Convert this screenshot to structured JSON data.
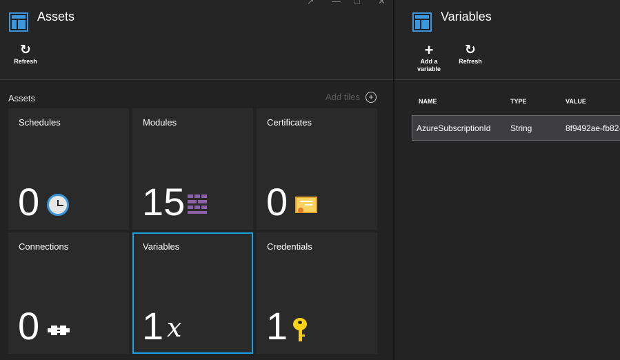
{
  "assets_blade": {
    "title": "Assets",
    "window_controls": [
      "↗",
      "—",
      "□",
      "✕"
    ],
    "commands": [
      {
        "icon": "refresh-icon",
        "label": "Refresh"
      }
    ],
    "section_title": "Assets",
    "add_tiles_label": "Add tiles",
    "tiles": [
      {
        "name": "Schedules",
        "count": "0",
        "icon": "clock-icon"
      },
      {
        "name": "Modules",
        "count": "15",
        "icon": "modules-icon"
      },
      {
        "name": "Certificates",
        "count": "0",
        "icon": "certificate-icon"
      },
      {
        "name": "Connections",
        "count": "0",
        "icon": "plug-icon"
      },
      {
        "name": "Variables",
        "count": "1",
        "icon": "variable-x-icon",
        "variable_symbol": "x",
        "selected": true
      },
      {
        "name": "Credentials",
        "count": "1",
        "icon": "key-icon"
      }
    ]
  },
  "variables_blade": {
    "title": "Variables",
    "commands": [
      {
        "icon": "plus-icon",
        "label_line1": "Add a",
        "label_line2": "variable"
      },
      {
        "icon": "refresh-icon",
        "label": "Refresh"
      }
    ],
    "columns": [
      "NAME",
      "TYPE",
      "VALUE"
    ],
    "rows": [
      {
        "name": "AzureSubscriptionId",
        "type": "String",
        "value": "8f9492ae-fb82-"
      }
    ]
  },
  "colors": {
    "accent_blue": "#1ba1e2",
    "blade_icon_blue": "#3a96dd",
    "tile_background": "#2a2a2a",
    "modules_purple": "#8c61a8",
    "key_yellow": "#fcd116"
  }
}
